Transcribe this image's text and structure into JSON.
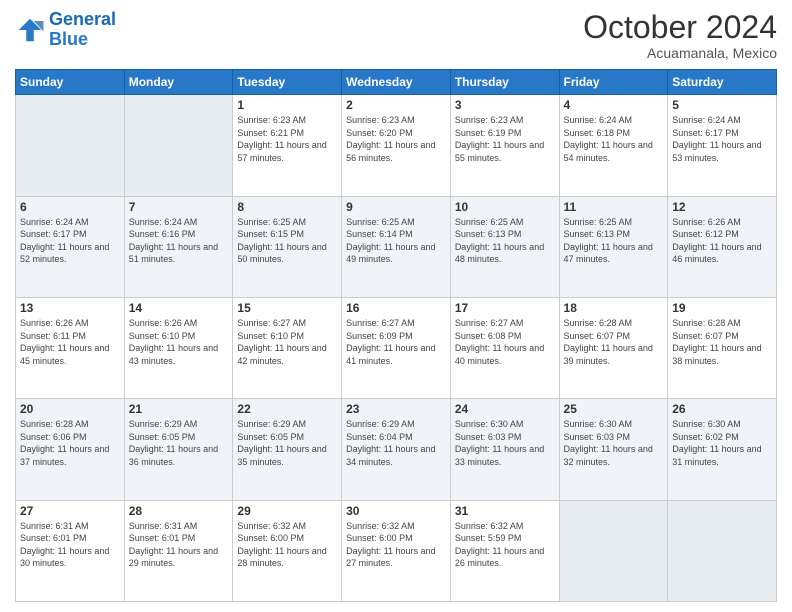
{
  "logo": {
    "line1": "General",
    "line2": "Blue"
  },
  "title": "October 2024",
  "location": "Acuamanala, Mexico",
  "days_of_week": [
    "Sunday",
    "Monday",
    "Tuesday",
    "Wednesday",
    "Thursday",
    "Friday",
    "Saturday"
  ],
  "weeks": [
    [
      {
        "day": "",
        "info": ""
      },
      {
        "day": "",
        "info": ""
      },
      {
        "day": "1",
        "info": "Sunrise: 6:23 AM\nSunset: 6:21 PM\nDaylight: 11 hours and 57 minutes."
      },
      {
        "day": "2",
        "info": "Sunrise: 6:23 AM\nSunset: 6:20 PM\nDaylight: 11 hours and 56 minutes."
      },
      {
        "day": "3",
        "info": "Sunrise: 6:23 AM\nSunset: 6:19 PM\nDaylight: 11 hours and 55 minutes."
      },
      {
        "day": "4",
        "info": "Sunrise: 6:24 AM\nSunset: 6:18 PM\nDaylight: 11 hours and 54 minutes."
      },
      {
        "day": "5",
        "info": "Sunrise: 6:24 AM\nSunset: 6:17 PM\nDaylight: 11 hours and 53 minutes."
      }
    ],
    [
      {
        "day": "6",
        "info": "Sunrise: 6:24 AM\nSunset: 6:17 PM\nDaylight: 11 hours and 52 minutes."
      },
      {
        "day": "7",
        "info": "Sunrise: 6:24 AM\nSunset: 6:16 PM\nDaylight: 11 hours and 51 minutes."
      },
      {
        "day": "8",
        "info": "Sunrise: 6:25 AM\nSunset: 6:15 PM\nDaylight: 11 hours and 50 minutes."
      },
      {
        "day": "9",
        "info": "Sunrise: 6:25 AM\nSunset: 6:14 PM\nDaylight: 11 hours and 49 minutes."
      },
      {
        "day": "10",
        "info": "Sunrise: 6:25 AM\nSunset: 6:13 PM\nDaylight: 11 hours and 48 minutes."
      },
      {
        "day": "11",
        "info": "Sunrise: 6:25 AM\nSunset: 6:13 PM\nDaylight: 11 hours and 47 minutes."
      },
      {
        "day": "12",
        "info": "Sunrise: 6:26 AM\nSunset: 6:12 PM\nDaylight: 11 hours and 46 minutes."
      }
    ],
    [
      {
        "day": "13",
        "info": "Sunrise: 6:26 AM\nSunset: 6:11 PM\nDaylight: 11 hours and 45 minutes."
      },
      {
        "day": "14",
        "info": "Sunrise: 6:26 AM\nSunset: 6:10 PM\nDaylight: 11 hours and 43 minutes."
      },
      {
        "day": "15",
        "info": "Sunrise: 6:27 AM\nSunset: 6:10 PM\nDaylight: 11 hours and 42 minutes."
      },
      {
        "day": "16",
        "info": "Sunrise: 6:27 AM\nSunset: 6:09 PM\nDaylight: 11 hours and 41 minutes."
      },
      {
        "day": "17",
        "info": "Sunrise: 6:27 AM\nSunset: 6:08 PM\nDaylight: 11 hours and 40 minutes."
      },
      {
        "day": "18",
        "info": "Sunrise: 6:28 AM\nSunset: 6:07 PM\nDaylight: 11 hours and 39 minutes."
      },
      {
        "day": "19",
        "info": "Sunrise: 6:28 AM\nSunset: 6:07 PM\nDaylight: 11 hours and 38 minutes."
      }
    ],
    [
      {
        "day": "20",
        "info": "Sunrise: 6:28 AM\nSunset: 6:06 PM\nDaylight: 11 hours and 37 minutes."
      },
      {
        "day": "21",
        "info": "Sunrise: 6:29 AM\nSunset: 6:05 PM\nDaylight: 11 hours and 36 minutes."
      },
      {
        "day": "22",
        "info": "Sunrise: 6:29 AM\nSunset: 6:05 PM\nDaylight: 11 hours and 35 minutes."
      },
      {
        "day": "23",
        "info": "Sunrise: 6:29 AM\nSunset: 6:04 PM\nDaylight: 11 hours and 34 minutes."
      },
      {
        "day": "24",
        "info": "Sunrise: 6:30 AM\nSunset: 6:03 PM\nDaylight: 11 hours and 33 minutes."
      },
      {
        "day": "25",
        "info": "Sunrise: 6:30 AM\nSunset: 6:03 PM\nDaylight: 11 hours and 32 minutes."
      },
      {
        "day": "26",
        "info": "Sunrise: 6:30 AM\nSunset: 6:02 PM\nDaylight: 11 hours and 31 minutes."
      }
    ],
    [
      {
        "day": "27",
        "info": "Sunrise: 6:31 AM\nSunset: 6:01 PM\nDaylight: 11 hours and 30 minutes."
      },
      {
        "day": "28",
        "info": "Sunrise: 6:31 AM\nSunset: 6:01 PM\nDaylight: 11 hours and 29 minutes."
      },
      {
        "day": "29",
        "info": "Sunrise: 6:32 AM\nSunset: 6:00 PM\nDaylight: 11 hours and 28 minutes."
      },
      {
        "day": "30",
        "info": "Sunrise: 6:32 AM\nSunset: 6:00 PM\nDaylight: 11 hours and 27 minutes."
      },
      {
        "day": "31",
        "info": "Sunrise: 6:32 AM\nSunset: 5:59 PM\nDaylight: 11 hours and 26 minutes."
      },
      {
        "day": "",
        "info": ""
      },
      {
        "day": "",
        "info": ""
      }
    ]
  ]
}
